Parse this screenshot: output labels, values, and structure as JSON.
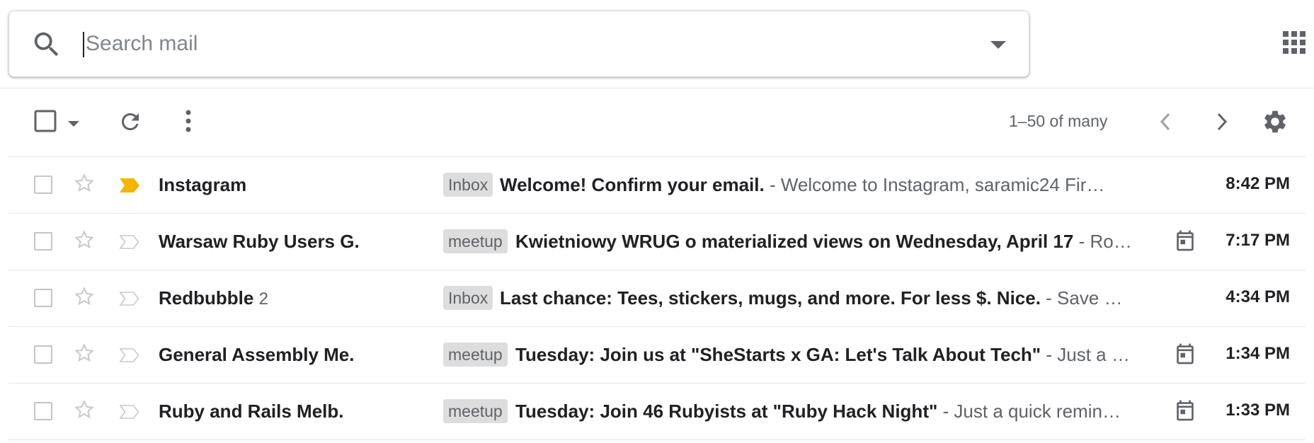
{
  "search": {
    "placeholder": "Search mail"
  },
  "toolbar": {
    "paging_text": "1–50 of many"
  },
  "colors": {
    "important_marker": "#f4b400",
    "label_bg": "#dddddd"
  },
  "icons": {
    "search": "search-icon",
    "dropdown": "caret-down-icon",
    "apps": "apps-grid-icon",
    "refresh": "refresh-icon",
    "more": "more-vert-icon",
    "prev": "chevron-left-icon",
    "next": "chevron-right-icon",
    "settings": "gear-icon",
    "star": "star-outline-icon",
    "important": "important-marker-icon",
    "calendar": "calendar-icon"
  },
  "emails": [
    {
      "sender": "Instagram",
      "count": "",
      "label": "Inbox",
      "subject": "Welcome! Confirm your email.",
      "snippet": " - Welcome to Instagram, saramic24 Fir…",
      "time": "8:42 PM",
      "important": true,
      "calendar": false
    },
    {
      "sender": "Warsaw Ruby Users G.",
      "count": "",
      "label": "meetup",
      "subject": "Kwietniowy WRUG o materialized views on Wednesday, April 17",
      "snippet": " - Ro…",
      "time": "7:17 PM",
      "important": false,
      "calendar": true
    },
    {
      "sender": "Redbubble",
      "count": "2",
      "label": "Inbox",
      "subject": "Last chance: Tees, stickers, mugs, and more. For less $. Nice.",
      "snippet": " - Save …",
      "time": "4:34 PM",
      "important": false,
      "calendar": false
    },
    {
      "sender": "General Assembly Me.",
      "count": "",
      "label": "meetup",
      "subject": "Tuesday: Join us at \"SheStarts x GA: Let's Talk About Tech\"",
      "snippet": " - Just a …",
      "time": "1:34 PM",
      "important": false,
      "calendar": true
    },
    {
      "sender": "Ruby and Rails Melb.",
      "count": "",
      "label": "meetup",
      "subject": "Tuesday: Join 46 Rubyists at \"Ruby Hack Night\"",
      "snippet": " - Just a quick remin…",
      "time": "1:33 PM",
      "important": false,
      "calendar": true
    }
  ]
}
